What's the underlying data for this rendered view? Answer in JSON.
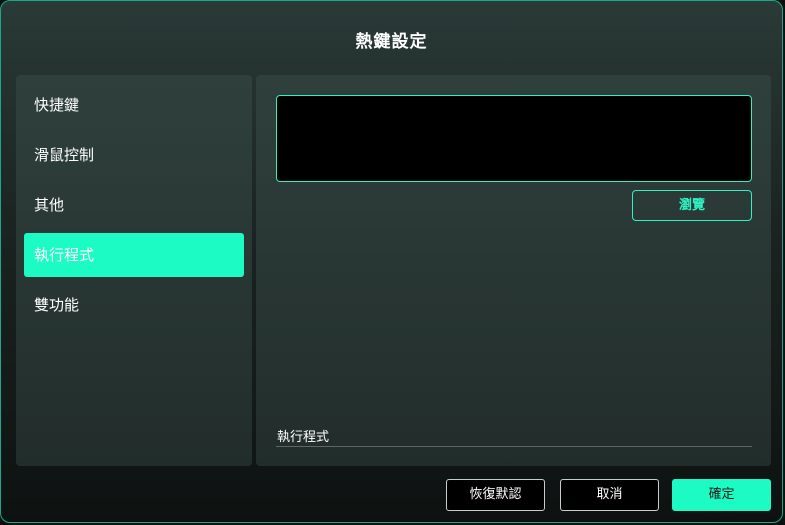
{
  "dialog": {
    "title": "熱鍵設定"
  },
  "sidebar": {
    "items": [
      {
        "label": "快捷鍵",
        "active": false
      },
      {
        "label": "滑鼠控制",
        "active": false
      },
      {
        "label": "其他",
        "active": false
      },
      {
        "label": "執行程式",
        "active": true
      },
      {
        "label": "雙功能",
        "active": false
      }
    ]
  },
  "content": {
    "path_value": "",
    "browse_label": "瀏覽",
    "program_label": "執行程式"
  },
  "footer": {
    "restore_label": "恢復默認",
    "cancel_label": "取消",
    "confirm_label": "確定"
  },
  "colors": {
    "accent": "#1dfbc4",
    "accent_border": "#2ef2c3",
    "border": "#19a98a"
  }
}
